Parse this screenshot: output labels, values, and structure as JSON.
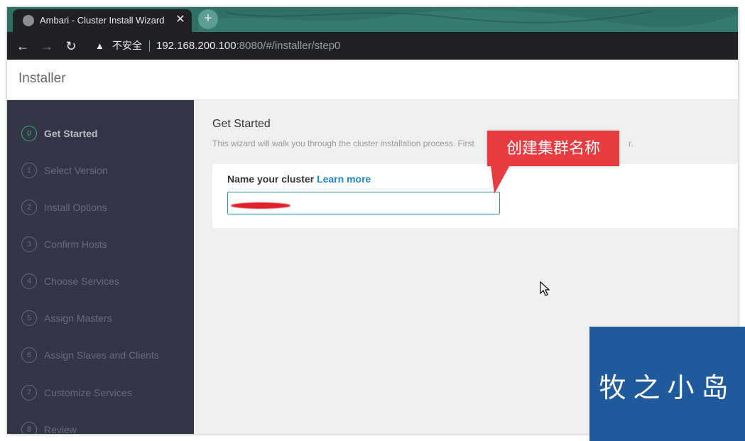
{
  "browser": {
    "tab_title": "Ambari - Cluster Install Wizard",
    "tab_close": "✕",
    "new_tab": "+",
    "back": "←",
    "forward": "→",
    "reload": "↻",
    "security_icon": "▲",
    "security_label": "不安全",
    "url_host": "192.168.200.100",
    "url_path": ":8080/#/installer/step0"
  },
  "app": {
    "title": "Installer"
  },
  "sidebar": {
    "steps": [
      {
        "num": "0",
        "label": "Get Started"
      },
      {
        "num": "1",
        "label": "Select Version"
      },
      {
        "num": "2",
        "label": "Install Options"
      },
      {
        "num": "3",
        "label": "Confirm Hosts"
      },
      {
        "num": "4",
        "label": "Choose Services"
      },
      {
        "num": "5",
        "label": "Assign Masters"
      },
      {
        "num": "6",
        "label": "Assign Slaves and Clients"
      },
      {
        "num": "7",
        "label": "Customize Services"
      },
      {
        "num": "8",
        "label": "Review"
      }
    ]
  },
  "main": {
    "heading": "Get Started",
    "description": "This wizard will walk you through the cluster installation process. First",
    "description_tail": "r.",
    "cluster_label": "Name your cluster",
    "learn_more": "Learn more",
    "cluster_value": ""
  },
  "annotation": {
    "callout_text": "创建集群名称"
  },
  "watermark": {
    "text": "牧之小岛"
  },
  "colors": {
    "sidebar_bg": "#323544",
    "active_step": "#3fae77",
    "link": "#1f86c7",
    "callout": "#e83c40",
    "watermark_bg": "#1e5a9c"
  }
}
